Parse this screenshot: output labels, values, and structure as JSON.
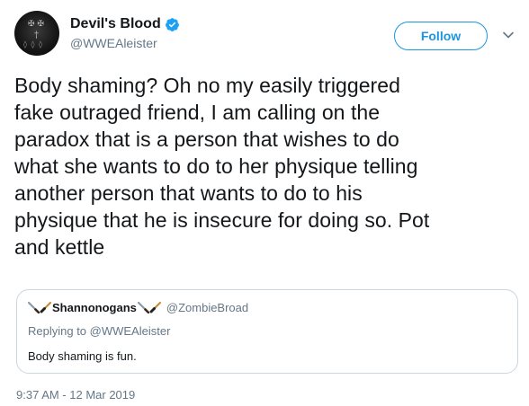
{
  "author": {
    "display_name": "Devil's Blood",
    "handle": "@WWEAleister",
    "verified_icon": "verified-badge-icon",
    "avatar_icon": "avatar-image"
  },
  "actions": {
    "follow_label": "Follow",
    "more_icon": "chevron-down-icon"
  },
  "tweet": {
    "text": "Body shaming? Oh no my easily triggered\nfake outraged friend, I am calling on the\nparadox that is a person that wishes to do\nwhat she wants to do to her physique telling\nanother person that wants to do to his\nphysique that he is insecure for doing so. Pot\nand kettle",
    "timestamp": "9:37 AM - 12 Mar 2019"
  },
  "quoted_tweet": {
    "display_name": "Shannonogans",
    "handle": "@ZombieBroad",
    "replying_to": "Replying to @WWEAleister",
    "text": "Body shaming is fun.",
    "name_emojis": [
      "knife-icon",
      "paintbrush-icon"
    ]
  },
  "colors": {
    "accent": "#1b95e0",
    "secondary_text": "#657786",
    "border": "#ccd6dd"
  }
}
